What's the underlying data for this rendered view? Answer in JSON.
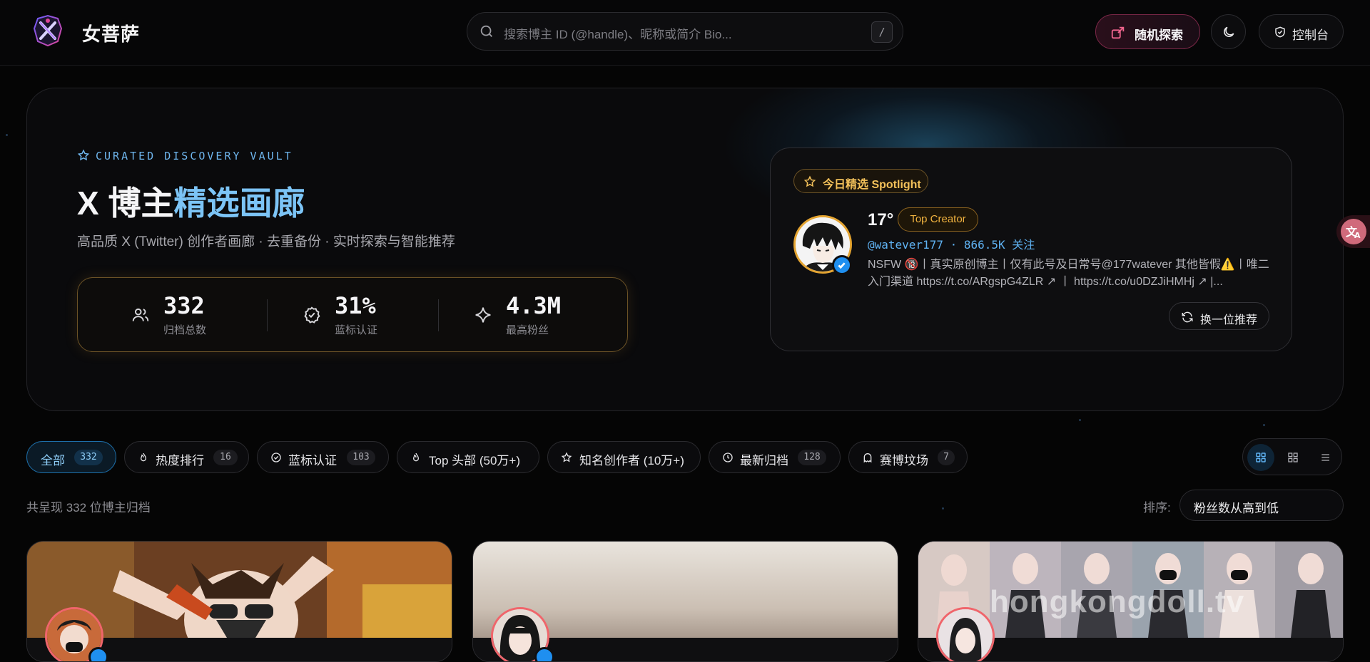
{
  "header": {
    "brand": "女菩萨",
    "search_placeholder": "搜索博主 ID (@handle)、昵称或简介 Bio...",
    "search_shortcut": "/",
    "random_label": "随机探索",
    "console_label": "控制台"
  },
  "hero": {
    "kicker": "CURATED DISCOVERY VAULT",
    "title_main": "X 博主",
    "title_highlight": "精选画廊",
    "subtitle": "高品质 X (Twitter) 创作者画廊 · 去重备份 · 实时探索与智能推荐",
    "stats": [
      {
        "value": "332",
        "label": "归档总数",
        "icon": "users-icon"
      },
      {
        "value": "31%",
        "label": "蓝标认证",
        "icon": "badge-check-icon"
      },
      {
        "value": "4.3M",
        "label": "最高粉丝",
        "icon": "sparkle-icon"
      }
    ]
  },
  "spotlight": {
    "badge": "今日精选 Spotlight",
    "name": "17°",
    "tag": "Top Creator",
    "handle": "@watever177 · 866.5K 关注",
    "bio": "NSFW 🔞丨真实原创博主丨仅有此号及日常号@177watever 其他皆假⚠️丨唯二入门渠道 https://t.co/ARgspG4ZLR ↗ 丨 https://t.co/u0DZJiHMHj ↗ |...",
    "swap_label": "换一位推荐"
  },
  "filters": [
    {
      "label": "全部",
      "count": "332",
      "icon": "",
      "active": true
    },
    {
      "label": "热度排行",
      "count": "16",
      "icon": "flame-icon"
    },
    {
      "label": "蓝标认证",
      "count": "103",
      "icon": "badge-check-icon"
    },
    {
      "label": "Top 头部 (50万+)",
      "count": "",
      "icon": "flame-icon"
    },
    {
      "label": "知名创作者 (10万+)",
      "count": "",
      "icon": "star-icon"
    },
    {
      "label": "最新归档",
      "count": "128",
      "icon": "clock-icon"
    },
    {
      "label": "赛博坟场",
      "count": "7",
      "icon": "ghost-icon"
    }
  ],
  "listing": {
    "count_text": "共呈现 332 位博主归档",
    "sort_label": "排序:",
    "sort_value": "粉丝数从高到低"
  },
  "cards": [
    {
      "watermark": ""
    },
    {
      "watermark": ""
    },
    {
      "watermark": "hongkongdoll.tv"
    }
  ],
  "colors": {
    "accent": "#7cc4f6",
    "gold": "#f3c15a",
    "pink": "#f0656b",
    "verified": "#1f8ff0"
  }
}
